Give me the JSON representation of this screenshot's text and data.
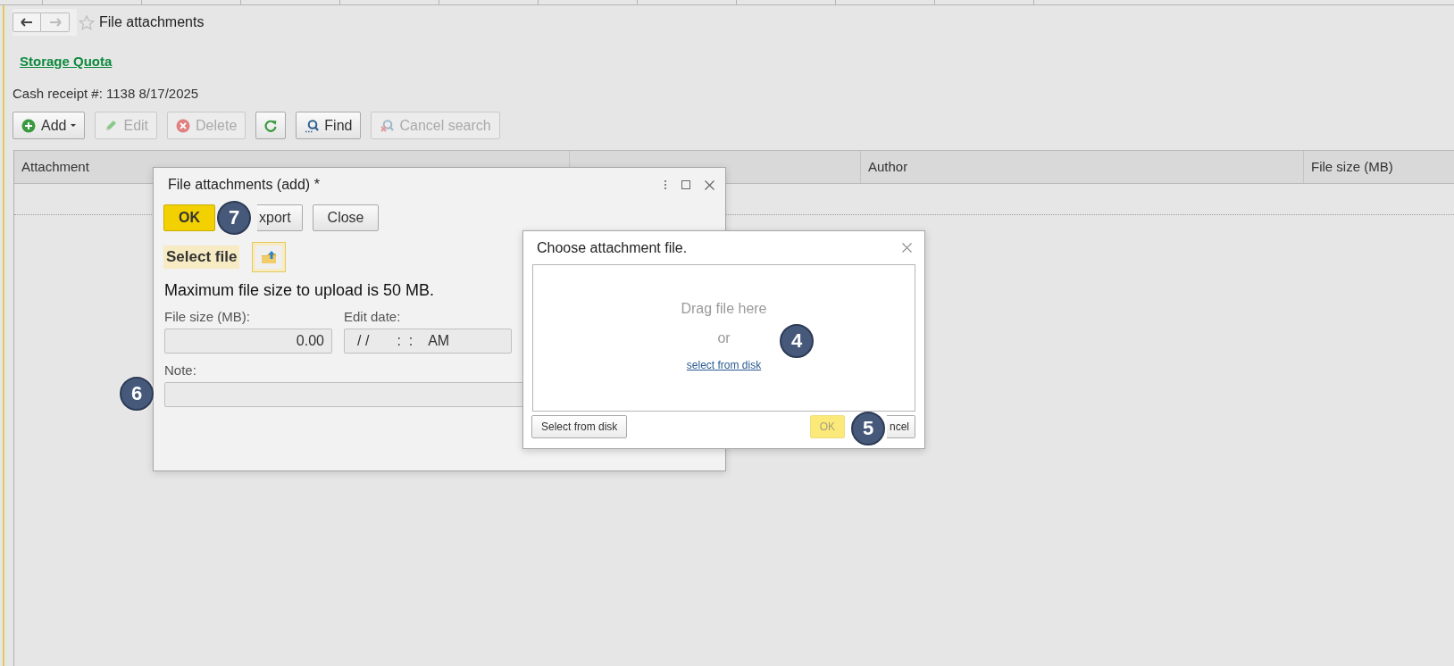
{
  "nav": {
    "back": {
      "disabled": false
    },
    "forward": {
      "disabled": true
    },
    "favorite": false
  },
  "title": "File attachments",
  "link": "Storage Quota",
  "subtitle": "Cash receipt #: 1138 8/17/2025",
  "toolbar": [
    {
      "label": "Add",
      "dropdown": true,
      "disabled": false
    },
    {
      "label": "Edit",
      "dropdown": false,
      "disabled": true
    },
    {
      "label": "Delete",
      "dropdown": false,
      "disabled": true
    },
    {
      "dropdown": false,
      "disabled": false
    },
    {
      "label": "Find",
      "dropdown": false,
      "disabled": false
    },
    {
      "label": "Cancel search",
      "dropdown": false,
      "disabled": true
    }
  ],
  "table": {
    "columns": [
      "Attachment",
      "Author",
      "File size (MB)"
    ]
  },
  "dialog": {
    "title": "File attachments (add) *",
    "buttons": [
      {
        "label": "OK",
        "kind": "primary",
        "disabled": false
      },
      {
        "label": "xport",
        "kind": "default",
        "disabled": false
      },
      {
        "label": "Close",
        "kind": "default",
        "disabled": false
      }
    ],
    "select_file_label": "Select file",
    "max_size_text": "Maximum file size to upload is 50 MB.",
    "fields": [
      {
        "label": "File size (MB):",
        "value": "0.00"
      },
      {
        "label": "Edit date:",
        "value": "/ /       :  :    AM"
      }
    ],
    "note_label": "Note:"
  },
  "file_dialog": {
    "title": "Choose attachment file.",
    "drop_text": "Drag file here",
    "or_text": "or",
    "link": "select from disk",
    "buttons": [
      {
        "label": "Select from disk",
        "kind": "default",
        "disabled": false
      },
      {
        "label": "OK",
        "kind": "primary",
        "disabled": true
      },
      {
        "label": "ncel",
        "kind": "default",
        "disabled": false
      }
    ]
  },
  "callouts": [
    {
      "number": "7"
    },
    {
      "number": "6"
    },
    {
      "number": "4"
    },
    {
      "number": "5"
    }
  ]
}
